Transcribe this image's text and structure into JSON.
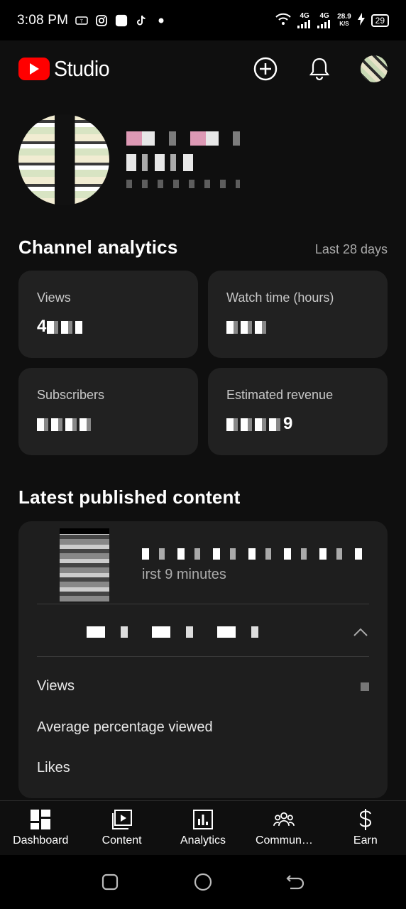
{
  "status_bar": {
    "time": "3:08 PM",
    "icons": [
      "temu-icon",
      "instagram-icon",
      "app-icon",
      "tiktok-icon",
      "dot-icon"
    ],
    "network_1": "4G",
    "network_2": "4G",
    "speed": "28.9",
    "speed_unit": "K/S",
    "battery": "29"
  },
  "header": {
    "app_name": "Studio",
    "create_label": "Create",
    "notifications_label": "Notifications",
    "account_label": "Account"
  },
  "analytics": {
    "title": "Channel analytics",
    "period": "Last 28 days",
    "cards": [
      {
        "label": "Views",
        "value": "4"
      },
      {
        "label": "Watch time (hours)",
        "value": ""
      },
      {
        "label": "Subscribers",
        "value": ""
      },
      {
        "label": "Estimated revenue",
        "value": "9"
      }
    ]
  },
  "latest": {
    "title": "Latest published content",
    "video_subtitle": "irst 9 minutes",
    "metrics": [
      {
        "label": "Views"
      },
      {
        "label": "Average percentage viewed"
      },
      {
        "label": "Likes"
      }
    ]
  },
  "bottom_nav": {
    "items": [
      {
        "label": "Dashboard",
        "icon": "dashboard-icon"
      },
      {
        "label": "Content",
        "icon": "content-icon"
      },
      {
        "label": "Analytics",
        "icon": "analytics-icon"
      },
      {
        "label": "Commun…",
        "icon": "community-icon"
      },
      {
        "label": "Earn",
        "icon": "earn-icon"
      }
    ]
  },
  "colors": {
    "background": "#0f0f0f",
    "card": "#212121",
    "brand_red": "#ff0000",
    "muted_text": "#aaaaaa"
  }
}
